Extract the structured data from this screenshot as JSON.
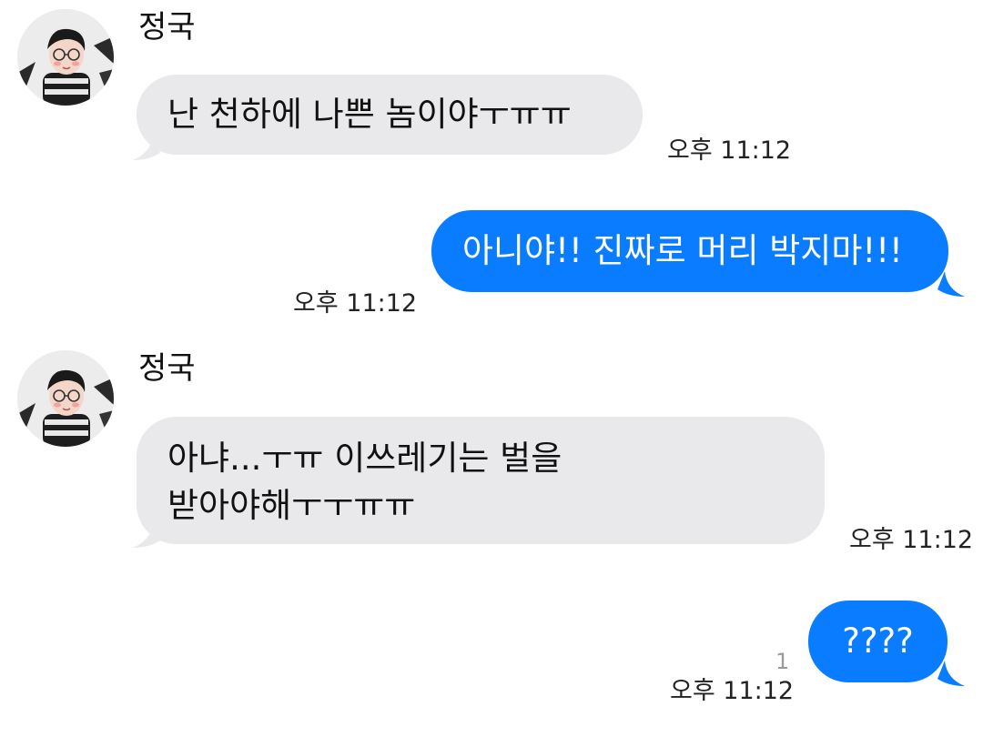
{
  "conversation": {
    "messages": [
      {
        "direction": "incoming",
        "sender": "정국",
        "avatar_icon": "profile-photo",
        "text": "난 천하에 나쁜 놈이야ㅜㅠㅠ",
        "time": "오후 11:12"
      },
      {
        "direction": "outgoing",
        "text": "아니야!! 진짜로 머리 박지마!!!",
        "time": "오후 11:12"
      },
      {
        "direction": "incoming",
        "sender": "정국",
        "avatar_icon": "profile-photo",
        "text": "아냐...ㅜㅠ 이쓰레기는 벌을\n받아야해ㅜㅜㅠㅠ",
        "time": "오후 11:12"
      },
      {
        "direction": "outgoing",
        "text": "????",
        "read_count": "1",
        "time": "오후 11:12"
      }
    ]
  },
  "colors": {
    "incoming_bubble": "#e9e9eb",
    "outgoing_bubble": "#0a7cff",
    "background": "#ffffff"
  }
}
